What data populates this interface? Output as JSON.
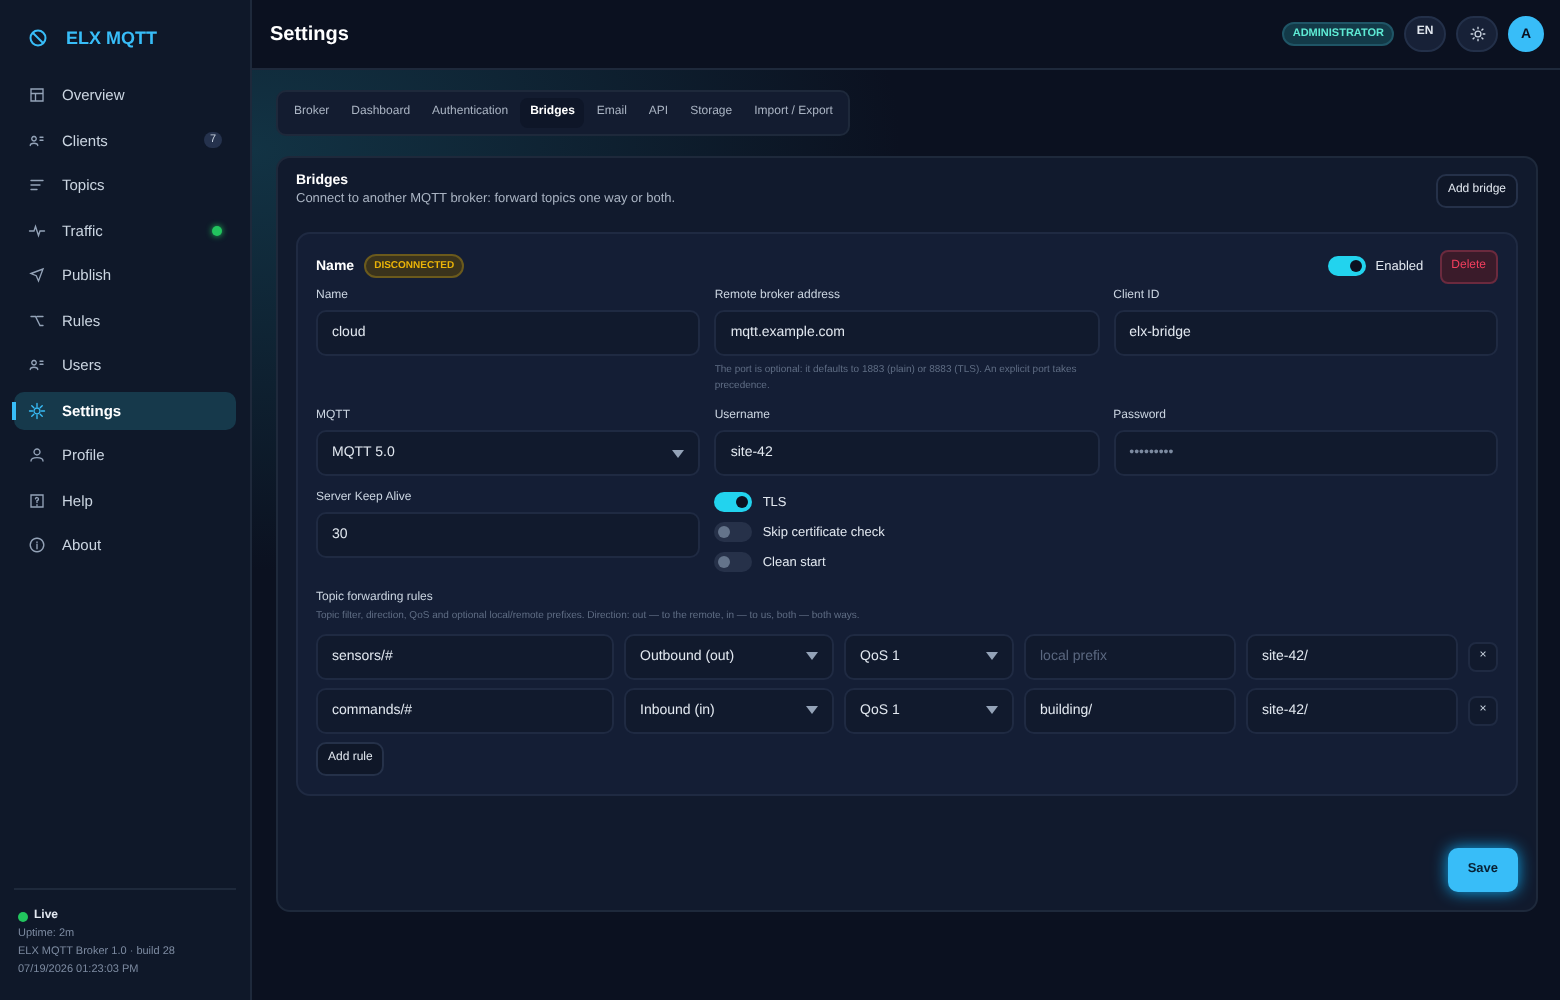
{
  "app": {
    "name": "ELX MQTT"
  },
  "sidebar": {
    "items": [
      {
        "label": "Overview",
        "selected": false
      },
      {
        "label": "Clients",
        "selected": false,
        "badge": "7"
      },
      {
        "label": "Topics",
        "selected": false
      },
      {
        "label": "Traffic",
        "selected": false,
        "live_dot": true
      },
      {
        "label": "Publish",
        "selected": false
      },
      {
        "label": "Rules",
        "selected": false
      },
      {
        "label": "Users",
        "selected": false
      },
      {
        "label": "Settings",
        "selected": true
      },
      {
        "label": "Profile",
        "selected": false
      },
      {
        "label": "Help",
        "selected": false
      },
      {
        "label": "About",
        "selected": false
      }
    ],
    "footer": {
      "status": "Live",
      "uptime": "Uptime: 2m",
      "version": "ELX MQTT Broker 1.0 · build 28",
      "timestamp": "07/19/2026 01:23:03 PM"
    }
  },
  "header": {
    "title": "Settings",
    "role": "ADMINISTRATOR",
    "language": "EN",
    "avatar": "A"
  },
  "tabs": [
    {
      "label": "Broker",
      "selected": false
    },
    {
      "label": "Dashboard",
      "selected": false
    },
    {
      "label": "Authentication",
      "selected": false
    },
    {
      "label": "Bridges",
      "selected": true
    },
    {
      "label": "Email",
      "selected": false
    },
    {
      "label": "API",
      "selected": false
    },
    {
      "label": "Storage",
      "selected": false
    },
    {
      "label": "Import / Export",
      "selected": false
    }
  ],
  "section": {
    "title": "Bridges",
    "description": "Connect to another MQTT broker: forward topics one way or both.",
    "add_button": "Add bridge"
  },
  "bridge": {
    "heading": "Name",
    "status": "DISCONNECTED",
    "enabled": {
      "label": "Enabled",
      "on": true
    },
    "delete_button": "Delete",
    "fields": [
      {
        "kind": "text",
        "label": "Name",
        "value": "cloud"
      },
      {
        "kind": "text",
        "label": "Remote broker address",
        "value": "mqtt.example.com",
        "hint": "The port is optional: it defaults to 1883 (plain) or 8883 (TLS). An explicit port takes precedence."
      },
      {
        "kind": "text",
        "label": "Client ID",
        "value": "elx-bridge"
      },
      {
        "kind": "select",
        "label": "MQTT",
        "value": "MQTT 5.0"
      },
      {
        "kind": "text",
        "label": "Username",
        "value": "site-42"
      },
      {
        "kind": "password",
        "label": "Password",
        "value": "•••••••••"
      },
      {
        "kind": "text",
        "label": "Server Keep Alive",
        "value": "30"
      }
    ],
    "toggles": [
      {
        "label": "TLS",
        "on": true
      },
      {
        "label": "Skip certificate check",
        "on": false
      },
      {
        "label": "Clean start",
        "on": false
      }
    ],
    "rules_title": "Topic forwarding rules",
    "rules_hint": "Topic filter, direction, QoS and optional local/remote prefixes. Direction: out — to the remote, in — to us, both — both ways.",
    "rules": [
      {
        "topic": "sensors/#",
        "direction": "Outbound (out)",
        "qos": "QoS 1",
        "local_prefix_placeholder": "local prefix",
        "remote_prefix": "site-42/",
        "remove": "×"
      },
      {
        "topic": "commands/#",
        "direction": "Inbound (in)",
        "qos": "QoS 1",
        "local_prefix": "building/",
        "remote_prefix": "site-42/",
        "remove": "×"
      }
    ],
    "add_rule": "Add rule"
  },
  "save_button": "Save"
}
